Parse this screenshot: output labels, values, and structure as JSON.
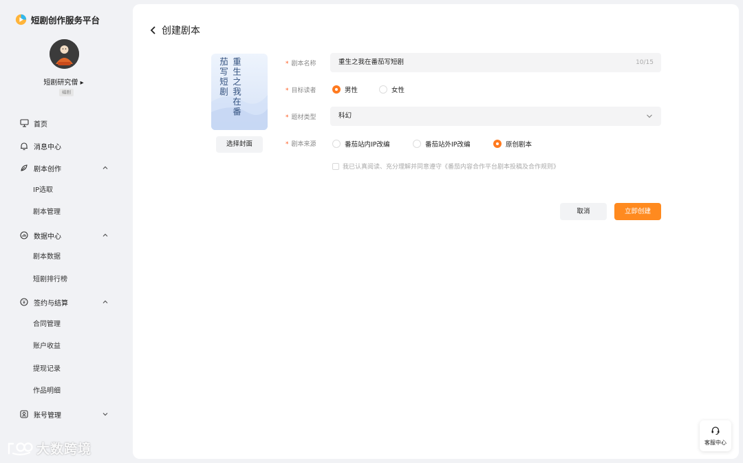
{
  "brand": {
    "title": "短剧创作服务平台"
  },
  "user": {
    "name": "短剧研究僧 ▸",
    "badge": "编剧"
  },
  "nav": {
    "home": "首页",
    "messages": "消息中心",
    "script_creation": "剧本创作",
    "ip_selection": "IP选取",
    "script_management": "剧本管理",
    "data_center": "数据中心",
    "script_data": "剧本数据",
    "drama_ranking": "短剧排行榜",
    "contract_settlement": "签约与结算",
    "contract_management": "合同管理",
    "account_income": "账户收益",
    "withdraw_records": "提现记录",
    "work_details": "作品明细",
    "account_management": "账号管理"
  },
  "page": {
    "title": "创建剧本"
  },
  "cover": {
    "text": "重生之我在番茄写短剧",
    "button": "选择封面"
  },
  "form": {
    "name_label": "剧本名称",
    "name_value": "重生之我在番茄写短剧",
    "name_count": "10/15",
    "audience_label": "目标读者",
    "audience_male": "男性",
    "audience_female": "女性",
    "genre_label": "题材类型",
    "genre_value": "科幻",
    "source_label": "剧本来源",
    "source_inside": "番茄站内IP改编",
    "source_outside": "番茄站外IP改编",
    "source_original": "原创剧本",
    "agreement": "我已认真阅读、充分理解并同意遵守《番茄内容合作平台剧本投稿及合作规则》",
    "required_mark": "*"
  },
  "actions": {
    "cancel": "取消",
    "create": "立即创建"
  },
  "service": {
    "label": "客服中心"
  },
  "watermark": {
    "text": "大数跨境"
  },
  "colors": {
    "accent": "#ff8a1f",
    "required": "#ff5a1f",
    "cover_text": "#34527f"
  }
}
